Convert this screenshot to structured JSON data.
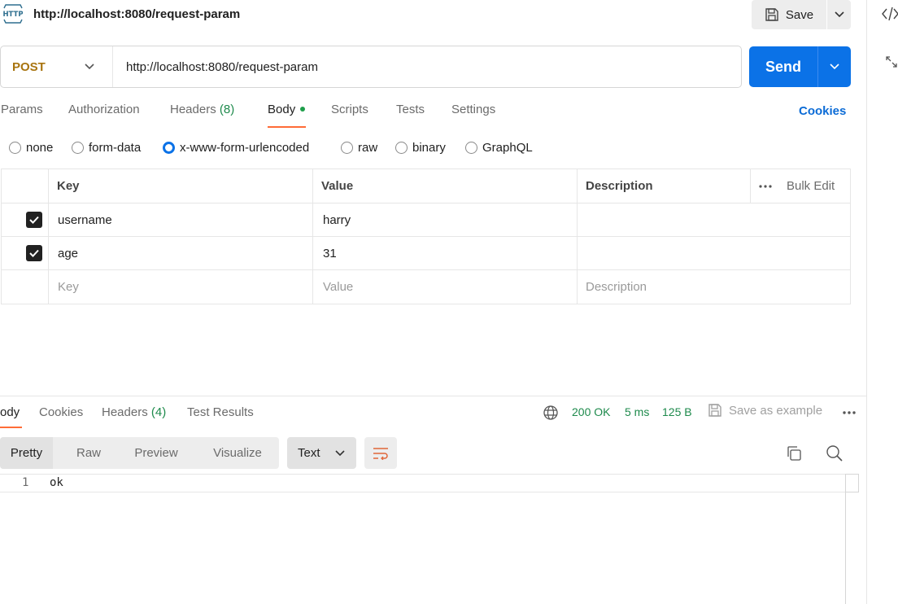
{
  "request": {
    "title": "http://localhost:8080/request-param",
    "save_label": "Save",
    "method": "POST",
    "url": "http://localhost:8080/request-param",
    "send_label": "Send",
    "tabs": [
      {
        "label": "Params"
      },
      {
        "label": "Authorization"
      },
      {
        "label": "Headers",
        "count": "(8)"
      },
      {
        "label": "Body"
      },
      {
        "label": "Scripts"
      },
      {
        "label": "Tests"
      },
      {
        "label": "Settings"
      }
    ],
    "cookies_label": "Cookies"
  },
  "body_types": [
    "none",
    "form-data",
    "x-www-form-urlencoded",
    "raw",
    "binary",
    "GraphQL"
  ],
  "params_table": {
    "headers": {
      "key": "Key",
      "value": "Value",
      "description": "Description",
      "bulk_edit": "Bulk Edit"
    },
    "rows": [
      {
        "key": "username",
        "value": "harry",
        "description": ""
      },
      {
        "key": "age",
        "value": "31",
        "description": ""
      }
    ],
    "placeholders": {
      "key": "Key",
      "value": "Value",
      "description": "Description"
    }
  },
  "response": {
    "tabs": [
      {
        "label": "ody"
      },
      {
        "label": "Cookies"
      },
      {
        "label": "Headers",
        "count": "(4)"
      },
      {
        "label": "Test Results"
      }
    ],
    "status": "200 OK",
    "time": "5 ms",
    "size": "125 B",
    "save_example_label": "Save as example",
    "views": [
      "Pretty",
      "Raw",
      "Preview",
      "Visualize"
    ],
    "format": "Text",
    "lines": [
      {
        "num": "1",
        "text": "ok"
      }
    ]
  },
  "colors": {
    "accent": "#ff6c37",
    "send": "#0b72e7",
    "method_post": "#a8740f",
    "status_ok": "#1e8a4c"
  }
}
